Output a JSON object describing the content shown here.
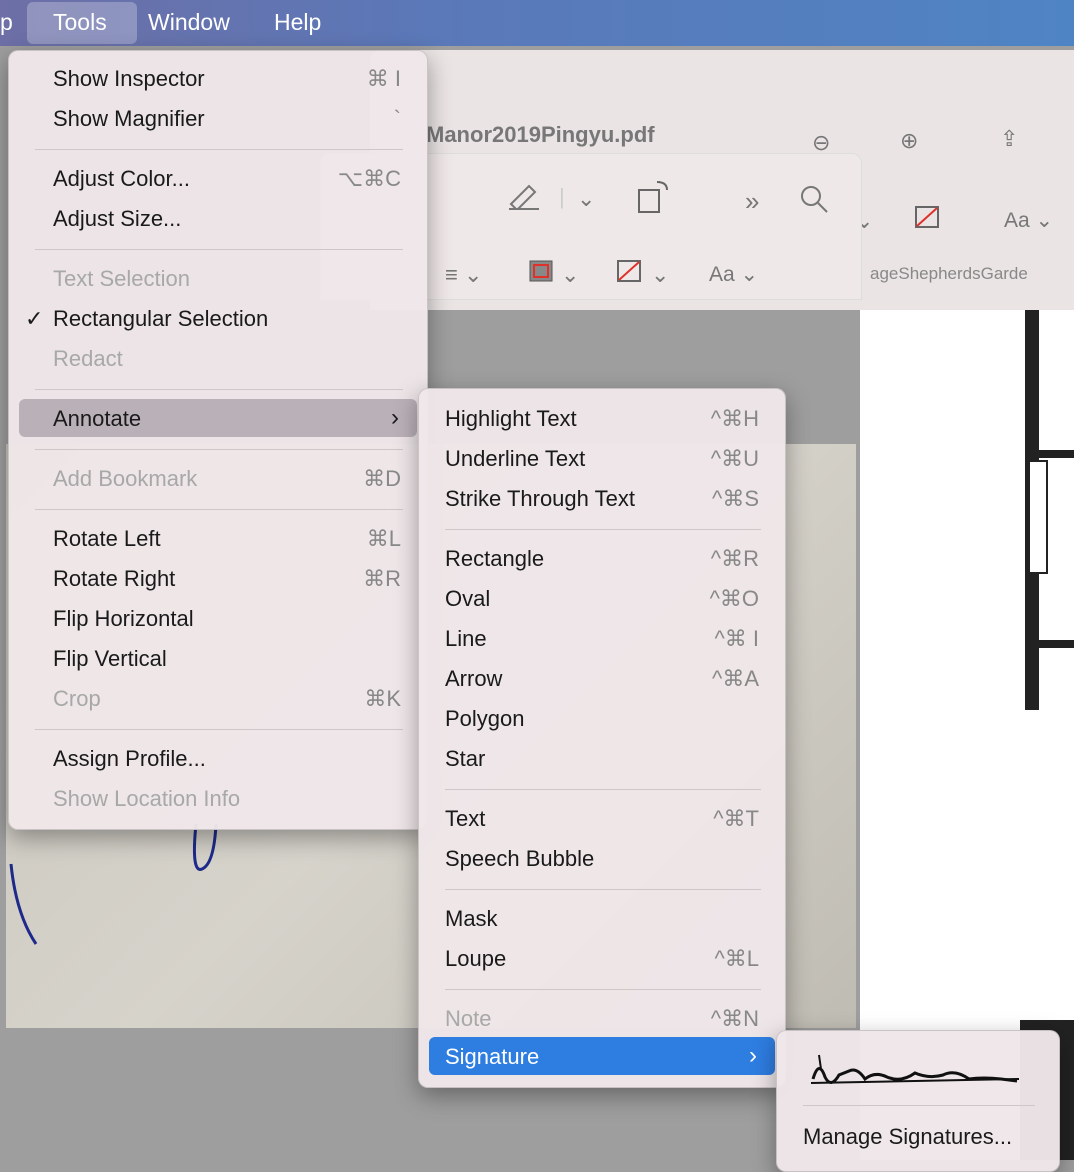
{
  "menubar": {
    "partial_left": "p",
    "items": [
      "Tools",
      "Window",
      "Help"
    ]
  },
  "window": {
    "title": "Manor2019Pingyu.pdf",
    "subtitle": "ageShepherdsGarde"
  },
  "tools_menu": {
    "items": [
      {
        "label": "Show Inspector",
        "shortcut": "⌘ I",
        "disabled": false
      },
      {
        "label": "Show Magnifier",
        "shortcut": "`",
        "disabled": false
      },
      {
        "label": "Adjust Color...",
        "shortcut": "⌥⌘C",
        "disabled": false
      },
      {
        "label": "Adjust Size...",
        "shortcut": "",
        "disabled": false
      },
      {
        "label": "Text Selection",
        "shortcut": "",
        "disabled": true
      },
      {
        "label": "Rectangular Selection",
        "shortcut": "",
        "disabled": false,
        "checked": true
      },
      {
        "label": "Redact",
        "shortcut": "",
        "disabled": true
      },
      {
        "label": "Annotate",
        "shortcut": "",
        "disabled": false,
        "submenu": true,
        "highlighted": true
      },
      {
        "label": "Add Bookmark",
        "shortcut": "⌘D",
        "disabled": true
      },
      {
        "label": "Rotate Left",
        "shortcut": "⌘L",
        "disabled": false
      },
      {
        "label": "Rotate Right",
        "shortcut": "⌘R",
        "disabled": false
      },
      {
        "label": "Flip Horizontal",
        "shortcut": "",
        "disabled": false
      },
      {
        "label": "Flip Vertical",
        "shortcut": "",
        "disabled": false
      },
      {
        "label": "Crop",
        "shortcut": "⌘K",
        "disabled": true
      },
      {
        "label": "Assign Profile...",
        "shortcut": "",
        "disabled": false
      },
      {
        "label": "Show Location Info",
        "shortcut": "",
        "disabled": true
      }
    ]
  },
  "annotate_menu": {
    "items": [
      {
        "label": "Highlight Text",
        "shortcut": "^⌘H",
        "disabled": false
      },
      {
        "label": "Underline Text",
        "shortcut": "^⌘U",
        "disabled": false
      },
      {
        "label": "Strike Through Text",
        "shortcut": "^⌘S",
        "disabled": false
      },
      {
        "label": "Rectangle",
        "shortcut": "^⌘R",
        "disabled": false
      },
      {
        "label": "Oval",
        "shortcut": "^⌘O",
        "disabled": false
      },
      {
        "label": "Line",
        "shortcut": "^⌘ I",
        "disabled": false
      },
      {
        "label": "Arrow",
        "shortcut": "^⌘A",
        "disabled": false
      },
      {
        "label": "Polygon",
        "shortcut": "",
        "disabled": false
      },
      {
        "label": "Star",
        "shortcut": "",
        "disabled": false
      },
      {
        "label": "Text",
        "shortcut": "^⌘T",
        "disabled": false
      },
      {
        "label": "Speech Bubble",
        "shortcut": "",
        "disabled": false
      },
      {
        "label": "Mask",
        "shortcut": "",
        "disabled": false
      },
      {
        "label": "Loupe",
        "shortcut": "^⌘L",
        "disabled": false
      },
      {
        "label": "Note",
        "shortcut": "^⌘N",
        "disabled": true
      },
      {
        "label": "Signature",
        "shortcut": "",
        "disabled": false,
        "submenu": true,
        "selected": true
      }
    ]
  },
  "signature_menu": {
    "manage_label": "Manage Signatures..."
  },
  "toolbar": {
    "font_label": "Aa",
    "font_label_back": "Aa"
  },
  "colors": {
    "menubar": "#5b78b8",
    "selected_item": "#2e7de1",
    "menu_bg": "#eee6e8"
  }
}
